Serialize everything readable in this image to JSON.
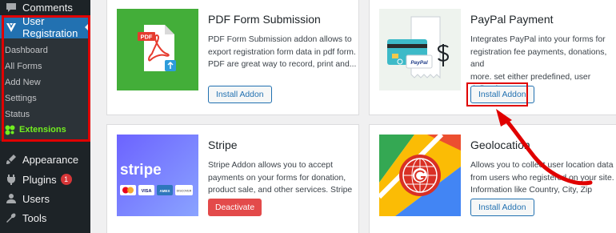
{
  "sidebar": {
    "comments": "Comments",
    "user_registration": "User Registration",
    "submenu": [
      "Dashboard",
      "All Forms",
      "Add New",
      "Settings",
      "Status",
      "Extensions"
    ],
    "appearance": "Appearance",
    "plugins": "Plugins",
    "plugins_badge": "1",
    "users": "Users",
    "tools": "Tools"
  },
  "addons": {
    "pdf": {
      "title": "PDF Form Submission",
      "desc_lines": [
        "PDF Form Submission addon allows to",
        "export registration form data in pdf form.",
        "PDF are great way to record, print and..."
      ],
      "button": "Install Addon",
      "thumb_text": "PDF"
    },
    "paypal": {
      "title": "PayPal Payment",
      "desc_lines": [
        "Integrates PayPal into your forms for",
        "registration fee payments, donations, and",
        "more. set either predefined, user defined..."
      ],
      "button": "Install Addon",
      "thumb_text": "PayPal"
    },
    "stripe": {
      "title": "Stripe",
      "desc_lines": [
        "Stripe Addon allows you to accept",
        "payments on your forms for donation,",
        "product sale, and other services. Stripe is..."
      ],
      "button": "Deactivate",
      "thumb_text": "stripe",
      "card_labels": [
        "VISA",
        "AMEX",
        "DISCOVER"
      ]
    },
    "geolocation": {
      "title": "Geolocation",
      "desc_lines": [
        "Allows you to collect user location data",
        "from users who registered on your site.",
        "Information like Country, City, Zip Code,..."
      ],
      "button": "Install Addon"
    }
  },
  "colors": {
    "sidebar_bg": "#1d2327",
    "sidebar_active": "#2271b1",
    "submenu_current": "#72ee1f",
    "highlight": "#e00000",
    "button_blue": "#2271b1",
    "deactivate_red": "#e34a4a"
  },
  "icons": {
    "comments": "speech-bubble-icon",
    "user_registration": "ur-logo-icon",
    "extensions": "puzzle-icon",
    "appearance": "paintbrush-icon",
    "plugins": "plug-icon",
    "users": "person-icon",
    "tools": "wrench-icon"
  }
}
